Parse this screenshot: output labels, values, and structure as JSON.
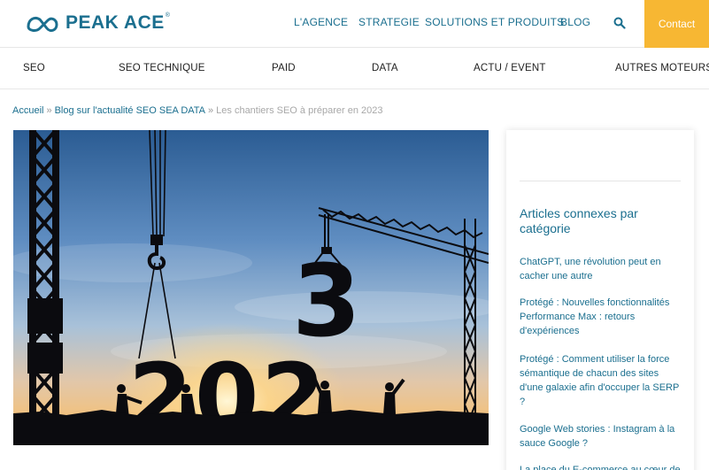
{
  "brand": {
    "name": "PEAK ACE",
    "registered_mark": "®",
    "primary_color": "#1b6f8f",
    "accent_color": "#f7b733"
  },
  "top_nav": {
    "items": [
      {
        "label": "L'AGENCE"
      },
      {
        "label": "STRATEGIE"
      },
      {
        "label": "SOLUTIONS ET PRODUITS"
      },
      {
        "label": "BLOG"
      }
    ],
    "search_icon": "search-icon",
    "contact_label": "Contact"
  },
  "category_nav": {
    "items": [
      {
        "label": "SEO"
      },
      {
        "label": "SEO TECHNIQUE"
      },
      {
        "label": "PAID"
      },
      {
        "label": "DATA"
      },
      {
        "label": "ACTU / EVENT"
      },
      {
        "label": "AUTRES MOTEURS"
      }
    ]
  },
  "breadcrumb": {
    "items": [
      {
        "label": "Accueil"
      },
      {
        "label": "Blog sur l'actualité SEO SEA DATA"
      }
    ],
    "separator": "»",
    "current": "Les chantiers SEO à préparer en 2023"
  },
  "hero": {
    "image_description": "construction-cranes-2023-sunset",
    "digits": [
      "2",
      "0",
      "2",
      "3"
    ]
  },
  "sidebar": {
    "title": "Articles connexes par catégorie",
    "related_articles": [
      {
        "label": "ChatGPT, une révolution peut en cacher une autre"
      },
      {
        "label": "Protégé : Nouvelles fonctionnalités Performance Max : retours d'expériences"
      },
      {
        "label": "Protégé : Comment utiliser la force sémantique de chacun des sites d'une galaxie afin d'occuper la SERP ?"
      },
      {
        "label": "Google Web stories : Instagram à la sauce Google ?"
      },
      {
        "label": "La place du E-commerce au cœur de"
      }
    ]
  }
}
